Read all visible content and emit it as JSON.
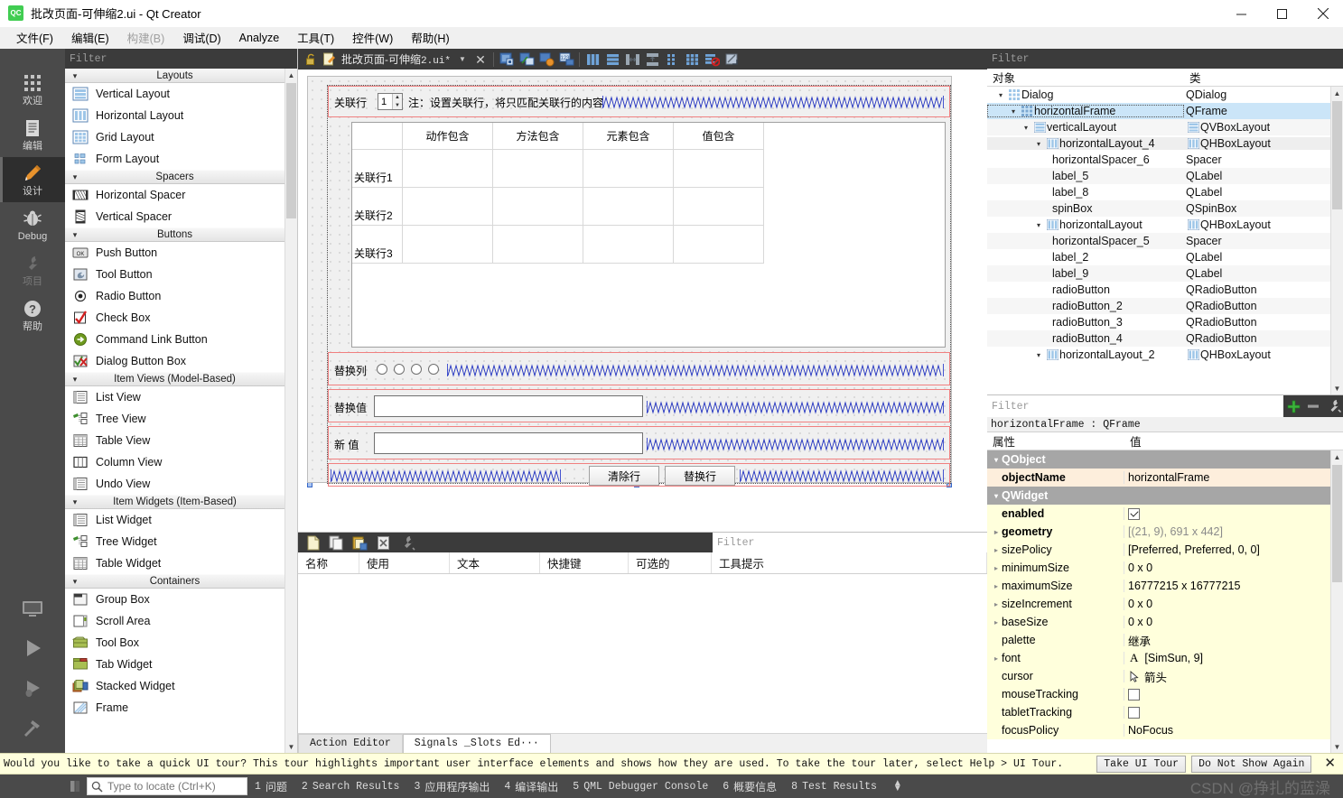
{
  "window": {
    "title": "批改页面-可伸缩2.ui - Qt Creator",
    "logo_text": "QC",
    "minimize_icon": "minimize-icon",
    "maximize_icon": "maximize-icon",
    "close_icon": "close-icon"
  },
  "menubar": {
    "items": [
      {
        "label": "文件(F)",
        "disabled": false
      },
      {
        "label": "编辑(E)",
        "disabled": false
      },
      {
        "label": "构建(B)",
        "disabled": true
      },
      {
        "label": "调试(D)",
        "disabled": false
      },
      {
        "label": "Analyze",
        "disabled": false
      },
      {
        "label": "工具(T)",
        "disabled": false
      },
      {
        "label": "控件(W)",
        "disabled": false
      },
      {
        "label": "帮助(H)",
        "disabled": false
      }
    ]
  },
  "modebar": {
    "items": [
      {
        "label": "欢迎",
        "icon": "grid-dots-icon",
        "state": "normal"
      },
      {
        "label": "编辑",
        "icon": "document-lines-icon",
        "state": "normal"
      },
      {
        "label": "设计",
        "icon": "pencil-icon",
        "state": "active"
      },
      {
        "label": "Debug",
        "icon": "bug-icon",
        "state": "normal"
      },
      {
        "label": "项目",
        "icon": "wrench-icon",
        "state": "disabled"
      },
      {
        "label": "帮助",
        "icon": "question-circle-icon",
        "state": "normal"
      }
    ],
    "bottom_buttons": [
      {
        "icon": "monitor-icon"
      },
      {
        "icon": "run-play-icon"
      },
      {
        "icon": "debug-play-icon"
      },
      {
        "icon": "hammer-icon"
      }
    ]
  },
  "widget_box": {
    "filter_placeholder": "Filter",
    "categories": [
      {
        "name": "Layouts",
        "items": [
          {
            "label": "Vertical Layout",
            "icon": "vertical-layout-icon"
          },
          {
            "label": "Horizontal Layout",
            "icon": "horizontal-layout-icon"
          },
          {
            "label": "Grid Layout",
            "icon": "grid-layout-icon"
          },
          {
            "label": "Form Layout",
            "icon": "form-layout-icon"
          }
        ]
      },
      {
        "name": "Spacers",
        "items": [
          {
            "label": "Horizontal Spacer",
            "icon": "horizontal-spacer-icon"
          },
          {
            "label": "Vertical Spacer",
            "icon": "vertical-spacer-icon"
          }
        ]
      },
      {
        "name": "Buttons",
        "items": [
          {
            "label": "Push Button",
            "icon": "push-button-icon"
          },
          {
            "label": "Tool Button",
            "icon": "tool-button-icon"
          },
          {
            "label": "Radio Button",
            "icon": "radio-button-icon"
          },
          {
            "label": "Check Box",
            "icon": "check-box-icon"
          },
          {
            "label": "Command Link Button",
            "icon": "command-link-button-icon"
          },
          {
            "label": "Dialog Button Box",
            "icon": "dialog-button-box-icon"
          }
        ]
      },
      {
        "name": "Item Views (Model-Based)",
        "items": [
          {
            "label": "List View",
            "icon": "list-view-icon"
          },
          {
            "label": "Tree View",
            "icon": "tree-view-icon"
          },
          {
            "label": "Table View",
            "icon": "table-view-icon"
          },
          {
            "label": "Column View",
            "icon": "column-view-icon"
          },
          {
            "label": "Undo View",
            "icon": "undo-view-icon"
          }
        ]
      },
      {
        "name": "Item Widgets (Item-Based)",
        "items": [
          {
            "label": "List Widget",
            "icon": "list-widget-icon"
          },
          {
            "label": "Tree Widget",
            "icon": "tree-widget-icon"
          },
          {
            "label": "Table Widget",
            "icon": "table-widget-icon"
          }
        ]
      },
      {
        "name": "Containers",
        "items": [
          {
            "label": "Group Box",
            "icon": "group-box-icon"
          },
          {
            "label": "Scroll Area",
            "icon": "scroll-area-icon"
          },
          {
            "label": "Tool Box",
            "icon": "tool-box-icon"
          },
          {
            "label": "Tab Widget",
            "icon": "tab-widget-icon"
          },
          {
            "label": "Stacked Widget",
            "icon": "stacked-widget-icon"
          },
          {
            "label": "Frame",
            "icon": "frame-icon"
          }
        ]
      }
    ]
  },
  "editor_toolbar": {
    "lock_icon": "unlock-icon",
    "file_icon": "ui-file-icon",
    "filename": "批改页面-可伸缩",
    "filename_suffix": "2.ui*",
    "dropdown_icon": "chevron-down-icon",
    "close_icon": "close-icon",
    "buttons": [
      {
        "icon": "edit-widgets-icon"
      },
      {
        "icon": "edit-signals-slots-icon"
      },
      {
        "icon": "edit-buddies-icon"
      },
      {
        "icon": "edit-tab-order-icon"
      },
      {
        "icon": "layout-horizontally-icon"
      },
      {
        "icon": "layout-vertically-icon"
      },
      {
        "icon": "layout-splitter-h-icon"
      },
      {
        "icon": "layout-splitter-v-icon"
      },
      {
        "icon": "layout-form-icon"
      },
      {
        "icon": "layout-grid-icon"
      },
      {
        "icon": "break-layout-icon"
      },
      {
        "icon": "adjust-size-icon"
      }
    ]
  },
  "form": {
    "geometry_label": "[(21, 9), 691 x 442]",
    "row_assoc": {
      "label": "关联行",
      "spin_value": "1",
      "note": "注：设置关联行，将只匹配关联行的内容"
    },
    "table": {
      "column_headers": [
        "动作包含",
        "方法包含",
        "元素包含",
        "值包含"
      ],
      "row_headers": [
        "关联行1",
        "关联行2",
        "关联行3"
      ]
    },
    "replace_col": {
      "label": "替换列",
      "radio_count": 4
    },
    "replace_val": {
      "label": "替换值",
      "value": ""
    },
    "new_val": {
      "label": "新  值",
      "value": ""
    },
    "buttons": [
      {
        "label": "清除行"
      },
      {
        "label": "替换行"
      }
    ]
  },
  "action_editor": {
    "toolbar_icons": [
      "new-action-icon",
      "copy-action-icon",
      "paste-action-icon",
      "delete-action-icon",
      "configure-icon"
    ],
    "filter_placeholder": "Filter",
    "columns": [
      "名称",
      "使用",
      "文本",
      "快捷键",
      "可选的",
      "工具提示"
    ],
    "rows": [],
    "tabs": [
      {
        "label": "Action Editor",
        "selected": false
      },
      {
        "label": "Signals _Slots Ed···",
        "selected": true
      }
    ]
  },
  "object_inspector": {
    "filter_placeholder": "Filter",
    "columns": [
      "对象",
      "类"
    ],
    "rows": [
      {
        "name": "Dialog",
        "class": "QDialog",
        "indent": 0,
        "twisty": "down",
        "icon": "grid-dots-icon",
        "class_icon": "",
        "selected": false
      },
      {
        "name": "horizontalFrame",
        "class": "QFrame",
        "indent": 1,
        "twisty": "down",
        "icon": "grid-dots-icon",
        "class_icon": "",
        "selected": true
      },
      {
        "name": "verticalLayout",
        "class": "QVBoxLayout",
        "indent": 2,
        "twisty": "down",
        "icon": "vertical-layout-icon",
        "class_icon": "vertical-layout-icon",
        "selected": false
      },
      {
        "name": "horizontalLayout_4",
        "class": "QHBoxLayout",
        "indent": 3,
        "twisty": "down",
        "icon": "horizontal-layout-icon",
        "class_icon": "horizontal-layout-icon",
        "selected": false
      },
      {
        "name": "horizontalSpacer_6",
        "class": "Spacer",
        "indent": 4,
        "twisty": "",
        "icon": "",
        "class_icon": "",
        "selected": false
      },
      {
        "name": "label_5",
        "class": "QLabel",
        "indent": 4,
        "twisty": "",
        "icon": "",
        "class_icon": "",
        "selected": false
      },
      {
        "name": "label_8",
        "class": "QLabel",
        "indent": 4,
        "twisty": "",
        "icon": "",
        "class_icon": "",
        "selected": false
      },
      {
        "name": "spinBox",
        "class": "QSpinBox",
        "indent": 4,
        "twisty": "",
        "icon": "",
        "class_icon": "",
        "selected": false
      },
      {
        "name": "horizontalLayout",
        "class": "QHBoxLayout",
        "indent": 3,
        "twisty": "down",
        "icon": "horizontal-layout-icon",
        "class_icon": "horizontal-layout-icon",
        "selected": false
      },
      {
        "name": "horizontalSpacer_5",
        "class": "Spacer",
        "indent": 4,
        "twisty": "",
        "icon": "",
        "class_icon": "",
        "selected": false
      },
      {
        "name": "label_2",
        "class": "QLabel",
        "indent": 4,
        "twisty": "",
        "icon": "",
        "class_icon": "",
        "selected": false
      },
      {
        "name": "label_9",
        "class": "QLabel",
        "indent": 4,
        "twisty": "",
        "icon": "",
        "class_icon": "",
        "selected": false
      },
      {
        "name": "radioButton",
        "class": "QRadioButton",
        "indent": 4,
        "twisty": "",
        "icon": "",
        "class_icon": "",
        "selected": false
      },
      {
        "name": "radioButton_2",
        "class": "QRadioButton",
        "indent": 4,
        "twisty": "",
        "icon": "",
        "class_icon": "",
        "selected": false
      },
      {
        "name": "radioButton_3",
        "class": "QRadioButton",
        "indent": 4,
        "twisty": "",
        "icon": "",
        "class_icon": "",
        "selected": false
      },
      {
        "name": "radioButton_4",
        "class": "QRadioButton",
        "indent": 4,
        "twisty": "",
        "icon": "",
        "class_icon": "",
        "selected": false
      },
      {
        "name": "horizontalLayout_2",
        "class": "QHBoxLayout",
        "indent": 3,
        "twisty": "down",
        "icon": "horizontal-layout-icon",
        "class_icon": "horizontal-layout-icon",
        "selected": false
      }
    ]
  },
  "property_editor": {
    "filter_placeholder": "Filter",
    "add_icon": "plus-icon",
    "remove_icon": "minus-icon",
    "config_icon": "wrench-icon",
    "object_line": "horizontalFrame : QFrame",
    "columns": [
      "属性",
      "值"
    ],
    "rows": [
      {
        "key": "QObject",
        "value": "",
        "kind": "group",
        "twisty": "down"
      },
      {
        "key": "objectName",
        "value": "horizontalFrame",
        "kind": "peach",
        "twisty": "",
        "bold": true
      },
      {
        "key": "QWidget",
        "value": "",
        "kind": "group",
        "twisty": "down"
      },
      {
        "key": "enabled",
        "value": "",
        "kind": "yellow",
        "twisty": "",
        "bold": true,
        "widget": "checkbox-on"
      },
      {
        "key": "geometry",
        "value": "[(21, 9), 691 x 442]",
        "kind": "yellow",
        "twisty": "right",
        "bold": true,
        "muted": true
      },
      {
        "key": "sizePolicy",
        "value": "[Preferred, Preferred, 0, 0]",
        "kind": "yellow",
        "twisty": "right"
      },
      {
        "key": "minimumSize",
        "value": "0 x 0",
        "kind": "yellow",
        "twisty": "right"
      },
      {
        "key": "maximumSize",
        "value": "16777215 x 16777215",
        "kind": "yellow",
        "twisty": "right"
      },
      {
        "key": "sizeIncrement",
        "value": "0 x 0",
        "kind": "yellow",
        "twisty": "right"
      },
      {
        "key": "baseSize",
        "value": "0 x 0",
        "kind": "yellow",
        "twisty": "right"
      },
      {
        "key": "palette",
        "value": "继承",
        "kind": "yellow",
        "twisty": ""
      },
      {
        "key": "font",
        "value": "[SimSun, 9]",
        "kind": "yellow",
        "twisty": "right",
        "widget": "font-A"
      },
      {
        "key": "cursor",
        "value": "箭头",
        "kind": "yellow",
        "twisty": "",
        "widget": "cursor-arrow"
      },
      {
        "key": "mouseTracking",
        "value": "",
        "kind": "yellow",
        "twisty": "",
        "widget": "checkbox-off"
      },
      {
        "key": "tabletTracking",
        "value": "",
        "kind": "yellow",
        "twisty": "",
        "widget": "checkbox-off"
      },
      {
        "key": "focusPolicy",
        "value": "NoFocus",
        "kind": "yellow",
        "twisty": ""
      }
    ]
  },
  "tour_banner": {
    "message": "Would you like to take a quick UI tour? This tour highlights important user interface elements and shows how they are used. To take the tour later, select Help > UI Tour.",
    "take_tour_label": "Take UI Tour",
    "dismiss_label": "Do Not Show Again",
    "close_icon": "close-icon"
  },
  "status_bar": {
    "locator_icon": "search-icon",
    "locator_placeholder": "Type to locate (Ctrl+K)",
    "panes": [
      {
        "num": "1",
        "label": "问题",
        "cn": true
      },
      {
        "num": "2",
        "label": "Search Results",
        "cn": false
      },
      {
        "num": "3",
        "label": "应用程序输出",
        "cn": true
      },
      {
        "num": "4",
        "label": "编译输出",
        "cn": true
      },
      {
        "num": "5",
        "label": "QML Debugger Console",
        "cn": false
      },
      {
        "num": "6",
        "label": "概要信息",
        "cn": true
      },
      {
        "num": "8",
        "label": "Test Results",
        "cn": false
      }
    ],
    "watermark": "CSDN @挣扎的蓝澡"
  },
  "colors": {
    "accent_blue": "#3667c8",
    "selection_blue": "#cbe5f8",
    "red_layout": "#f08080",
    "dark_chrome": "#3b3b3b",
    "mode_bar": "#4a4a4a",
    "banner_yellow": "#ffffdd",
    "property_yellow": "#ffffdc",
    "property_peach": "#fdeedc"
  }
}
